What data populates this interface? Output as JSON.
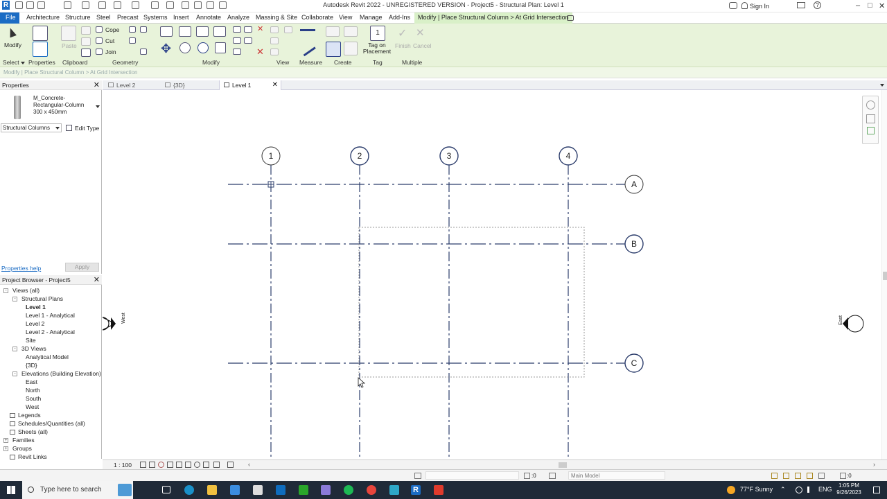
{
  "app": {
    "window_title": "Autodesk Revit 2022 - UNREGISTERED VERSION - Project5 - Structural Plan: Level 1",
    "sign_in": "Sign In"
  },
  "ribbon_tabs": [
    "File",
    "Architecture",
    "Structure",
    "Steel",
    "Precast",
    "Systems",
    "Insert",
    "Annotate",
    "Analyze",
    "Massing & Site",
    "Collaborate",
    "View",
    "Manage",
    "Add-Ins",
    "Modify | Place Structural Column > At Grid Intersection"
  ],
  "ribbon": {
    "modify": "Modify",
    "paste": "Paste",
    "cope": "Cope",
    "cut": "Cut",
    "join": "Join",
    "tag_on_placement": "Tag on Placement",
    "finish": "Finish",
    "cancel": "Cancel",
    "panels": [
      "Select",
      "Properties",
      "Clipboard",
      "Geometry",
      "Modify",
      "View",
      "Measure",
      "Create",
      "Tag",
      "Multiple"
    ]
  },
  "options_bar": {
    "text": "Modify | Place Structural Column > At Grid Intersection"
  },
  "properties": {
    "header": "Properties",
    "type_name_line1": "M_Concrete-",
    "type_name_line2": "Rectangular-Column",
    "type_size": "300 x 450mm",
    "category": "Structural Columns",
    "edit_type": "Edit Type",
    "help_link": "Properties help",
    "apply": "Apply"
  },
  "project_browser": {
    "header": "Project Browser - Project5",
    "items": [
      {
        "label": "Views (all)",
        "level": 0,
        "toggle": "-"
      },
      {
        "label": "Structural Plans",
        "level": 1,
        "toggle": "-"
      },
      {
        "label": "Level 1",
        "level": 2,
        "bold": true
      },
      {
        "label": "Level 1 - Analytical",
        "level": 2
      },
      {
        "label": "Level 2",
        "level": 2
      },
      {
        "label": "Level 2 - Analytical",
        "level": 2
      },
      {
        "label": "Site",
        "level": 2
      },
      {
        "label": "3D Views",
        "level": 1,
        "toggle": "-"
      },
      {
        "label": "Analytical Model",
        "level": 2
      },
      {
        "label": "{3D}",
        "level": 2
      },
      {
        "label": "Elevations (Building Elevation)",
        "level": 1,
        "toggle": "-"
      },
      {
        "label": "East",
        "level": 2
      },
      {
        "label": "North",
        "level": 2
      },
      {
        "label": "South",
        "level": 2
      },
      {
        "label": "West",
        "level": 2
      },
      {
        "label": "Legends",
        "level": 0,
        "icon": true
      },
      {
        "label": "Schedules/Quantities (all)",
        "level": 0,
        "icon": true
      },
      {
        "label": "Sheets (all)",
        "level": 0,
        "icon": true
      },
      {
        "label": "Families",
        "level": 0,
        "toggle": "+"
      },
      {
        "label": "Groups",
        "level": 0,
        "toggle": "+"
      },
      {
        "label": "Revit Links",
        "level": 0,
        "icon": true
      }
    ]
  },
  "view_tabs": [
    {
      "label": "Level 2",
      "active": false
    },
    {
      "label": "{3D}",
      "active": false
    },
    {
      "label": "Level 1",
      "active": true
    }
  ],
  "grid": {
    "vertical": [
      "1",
      "2",
      "3",
      "4"
    ],
    "horizontal": [
      "A",
      "B",
      "C"
    ],
    "elevation_west": "West",
    "elevation_east": "East"
  },
  "status": {
    "scale": "1 : 100",
    "model": "Main Model",
    "zero": ":0"
  },
  "taskbar": {
    "search_placeholder": "Type here to search",
    "weather": "77°F  Sunny",
    "lang": "ENG",
    "time": "1:05 PM",
    "date": "9/26/2023"
  },
  "colors": {
    "accent": "#1b6cc4",
    "ribbon_bg": "#e8f3da",
    "grid_line": "#2b3c6b",
    "taskbar_bg": "#1f2a38"
  }
}
